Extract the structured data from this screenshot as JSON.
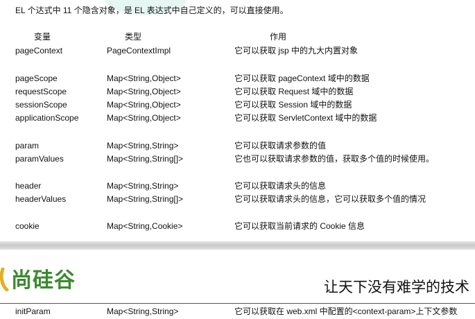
{
  "intro": "EL 个达式中 11 个隐含对象，是 EL 表达式中自己定义的，可以直接使用。",
  "columns": {
    "variable": "变量",
    "type": "类型",
    "purpose": "作用"
  },
  "rows": [
    {
      "name": "pageContext",
      "type": "PageContextImpl",
      "desc": "它可以获取 jsp 中的九大内置对象"
    },
    {
      "name": "pageScope",
      "type": "Map<String,Object>",
      "desc": "它可以获取 pageContext 域中的数据"
    },
    {
      "name": "requestScope",
      "type": "Map<String,Object>",
      "desc": "它可以获取 Request 域中的数据"
    },
    {
      "name": "sessionScope",
      "type": "Map<String,Object>",
      "desc": "它可以获取 Session 域中的数据"
    },
    {
      "name": "applicationScope",
      "type": "Map<String,Object>",
      "desc": "它可以获取 ServletContext 域中的数据"
    },
    {
      "name": "param",
      "type": "Map<String,String>",
      "desc": "它可以获取请求参数的值"
    },
    {
      "name": "paramValues",
      "type": "Map<String,String[]>",
      "desc": "它也可以获取请求参数的值，获取多个值的时候使用。"
    },
    {
      "name": "header",
      "type": "Map<String,String>",
      "desc": "它可以获取请求头的信息"
    },
    {
      "name": "headerValues",
      "type": "Map<String,String[]>",
      "desc": "它可以获取请求头的信息，它可以获取多个值的情况"
    },
    {
      "name": "cookie",
      "type": "Map<String,Cookie>",
      "desc": "它可以获取当前请求的 Cookie 信息"
    }
  ],
  "footer": {
    "logo_text": "尚硅谷",
    "slogan": "让天下没有难学的技术",
    "brand_color": "#3a8a2e"
  },
  "bottom_row": {
    "name": "initParam",
    "type": "Map<String,String>",
    "desc": "它可以获取在 web.xml 中配置的<context-param>上下文参数"
  }
}
